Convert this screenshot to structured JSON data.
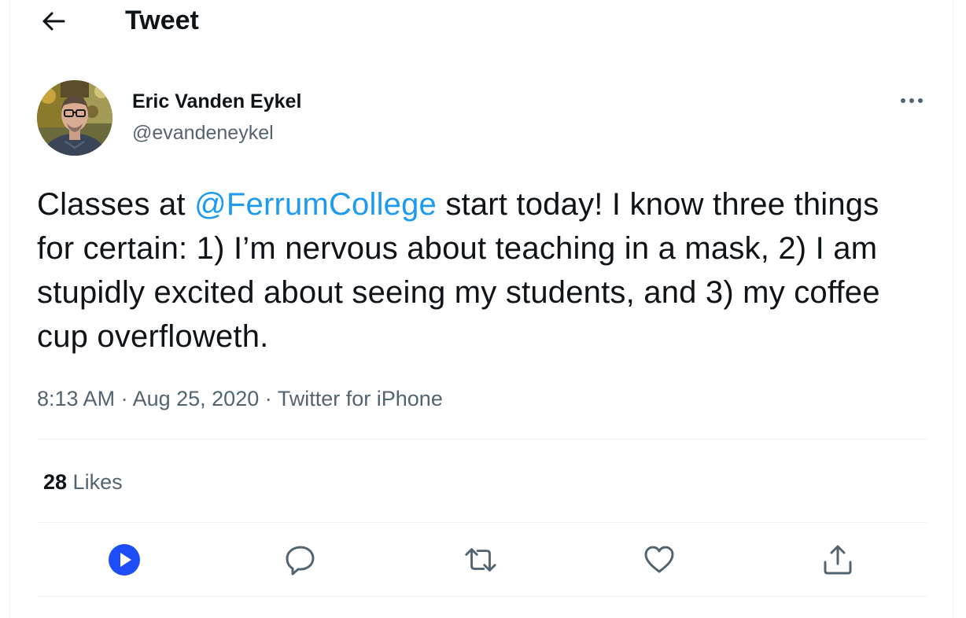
{
  "header": {
    "back_icon": "arrow-left-icon",
    "title": "Tweet"
  },
  "tweet": {
    "author": {
      "name": "Eric Vanden Eykel",
      "handle": "@evandeneykel",
      "avatar": "profile-photo"
    },
    "more_icon": "more-horizontal-icon",
    "text_before_mention": "Classes at ",
    "mention": "@FerrumCollege",
    "text_after_mention": " start today! I know three things for certain: 1) I’m nervous about teaching in a mask, 2) I am stupidly excited about seeing my students, and 3) my coffee cup overfloweth.",
    "time": "8:13 AM",
    "separator": " · ",
    "date": "Aug 25, 2020",
    "source": "Twitter for iPhone",
    "likes_count": "28",
    "likes_label": " Likes"
  },
  "actions": [
    {
      "icon": "play-icon"
    },
    {
      "icon": "reply-icon"
    },
    {
      "icon": "retweet-icon"
    },
    {
      "icon": "like-icon"
    },
    {
      "icon": "share-icon"
    }
  ],
  "colors": {
    "accent": "#1d9bf0",
    "play_button": "#1d4ef5",
    "secondary_text": "#536471",
    "divider": "#eff3f4"
  }
}
